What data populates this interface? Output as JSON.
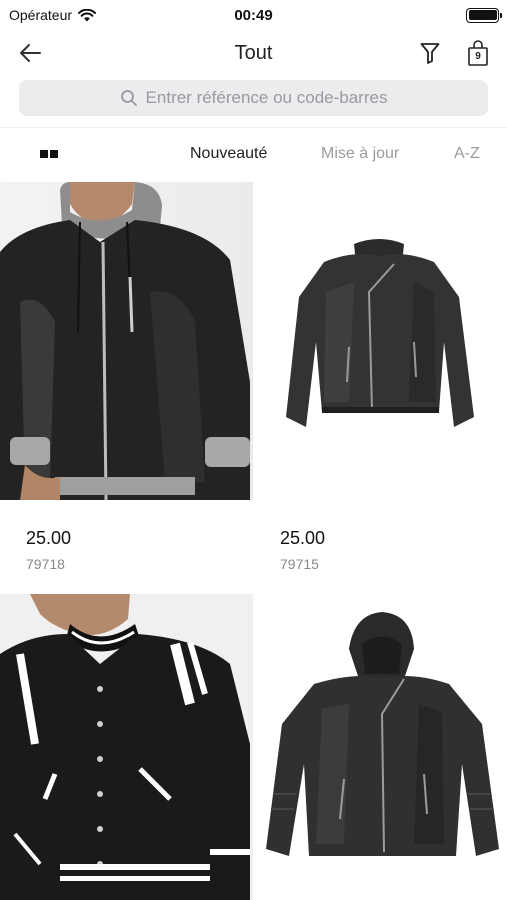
{
  "status_bar": {
    "carrier": "Opérateur",
    "time": "00:49"
  },
  "nav": {
    "title": "Tout",
    "cart_count": "9"
  },
  "search": {
    "placeholder": "Entrer référence ou code-barres"
  },
  "sort": {
    "options": [
      {
        "label": "Nouveauté",
        "active": true
      },
      {
        "label": "Mise à jour",
        "active": false
      },
      {
        "label": "A-Z",
        "active": false
      }
    ]
  },
  "colors": {
    "accent_text": "#222222",
    "inactive_text": "#9b9b9b",
    "search_bg": "#ececee"
  },
  "products": [
    {
      "price": "25.00",
      "reference": "79718",
      "image_icon": "black-leather-jacket-on-model-photo"
    },
    {
      "price": "25.00",
      "reference": "79715",
      "image_icon": "black-biker-jacket-photo"
    },
    {
      "price": "",
      "reference": "",
      "image_icon": "black-varsity-jacket-on-model-photo"
    },
    {
      "price": "",
      "reference": "",
      "image_icon": "black-hooded-jacket-photo"
    }
  ]
}
